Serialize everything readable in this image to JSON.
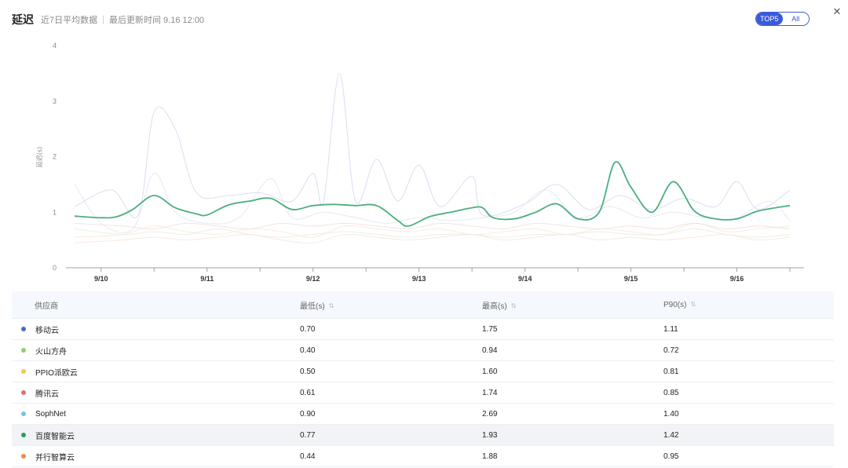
{
  "header": {
    "title": "延迟",
    "subtitle": "近7日平均数据",
    "separator": "|",
    "updated": "最后更新时间 9.16 12:00"
  },
  "toggle": {
    "option_top5": "TOP5",
    "option_all": "All"
  },
  "close_icon": "close-icon",
  "chart_data": {
    "type": "line",
    "ylabel": "延迟(s)",
    "ylim": [
      0,
      4
    ],
    "yticks": [
      "0",
      "1",
      "2",
      "3",
      "4"
    ],
    "x_labels": [
      "9/10",
      "9/11",
      "9/12",
      "9/13",
      "9/14",
      "9/15",
      "9/16"
    ],
    "x_range": [
      -0.25,
      6.5
    ],
    "grid": false,
    "highlight_color": "#4caf7d",
    "series": [
      {
        "name": "百度智能云",
        "color": "#4caf7d",
        "highlight": true,
        "points": [
          [
            -0.25,
            0.93
          ],
          [
            0.0,
            0.9
          ],
          [
            0.15,
            0.92
          ],
          [
            0.3,
            1.05
          ],
          [
            0.5,
            1.3
          ],
          [
            0.7,
            1.08
          ],
          [
            0.9,
            0.97
          ],
          [
            1.0,
            0.95
          ],
          [
            1.2,
            1.13
          ],
          [
            1.4,
            1.2
          ],
          [
            1.6,
            1.25
          ],
          [
            1.8,
            1.05
          ],
          [
            2.0,
            1.12
          ],
          [
            2.2,
            1.14
          ],
          [
            2.4,
            1.12
          ],
          [
            2.6,
            1.12
          ],
          [
            2.8,
            0.85
          ],
          [
            2.9,
            0.75
          ],
          [
            3.1,
            0.92
          ],
          [
            3.3,
            1.0
          ],
          [
            3.5,
            1.08
          ],
          [
            3.6,
            1.08
          ],
          [
            3.7,
            0.9
          ],
          [
            3.9,
            0.88
          ],
          [
            4.1,
            1.0
          ],
          [
            4.3,
            1.15
          ],
          [
            4.5,
            0.88
          ],
          [
            4.7,
            1.0
          ],
          [
            4.85,
            1.9
          ],
          [
            5.0,
            1.45
          ],
          [
            5.2,
            1.0
          ],
          [
            5.4,
            1.55
          ],
          [
            5.6,
            1.02
          ],
          [
            5.8,
            0.88
          ],
          [
            6.0,
            0.88
          ],
          [
            6.2,
            1.02
          ],
          [
            6.5,
            1.12
          ]
        ]
      },
      {
        "name": "SophNet",
        "color": "#cfd6ee",
        "highlight": false,
        "points": [
          [
            -0.25,
            1.1
          ],
          [
            0.1,
            1.4
          ],
          [
            0.35,
            0.95
          ],
          [
            0.5,
            2.8
          ],
          [
            0.7,
            2.5
          ],
          [
            0.9,
            1.35
          ],
          [
            1.2,
            1.3
          ],
          [
            1.5,
            1.35
          ],
          [
            1.8,
            1.2
          ],
          [
            2.0,
            1.7
          ],
          [
            2.1,
            1.2
          ],
          [
            2.25,
            3.5
          ],
          [
            2.4,
            1.2
          ],
          [
            2.6,
            1.95
          ],
          [
            2.8,
            1.2
          ],
          [
            3.0,
            1.85
          ],
          [
            3.2,
            1.1
          ],
          [
            3.5,
            1.65
          ],
          [
            3.6,
            0.95
          ],
          [
            4.0,
            1.15
          ],
          [
            4.3,
            1.5
          ],
          [
            4.6,
            1.05
          ],
          [
            4.9,
            1.3
          ],
          [
            5.2,
            1.05
          ],
          [
            5.5,
            1.25
          ],
          [
            5.8,
            1.1
          ],
          [
            6.0,
            1.55
          ],
          [
            6.2,
            1.05
          ],
          [
            6.5,
            1.4
          ]
        ]
      },
      {
        "name": "移动云",
        "color": "#dfe4f2",
        "highlight": false,
        "points": [
          [
            -0.25,
            1.5
          ],
          [
            0.0,
            0.8
          ],
          [
            0.3,
            0.7
          ],
          [
            0.5,
            1.7
          ],
          [
            0.7,
            1.0
          ],
          [
            1.0,
            0.8
          ],
          [
            1.3,
            0.9
          ],
          [
            1.6,
            1.6
          ],
          [
            1.8,
            0.9
          ],
          [
            2.1,
            1.0
          ],
          [
            2.4,
            0.9
          ],
          [
            2.7,
            0.8
          ],
          [
            3.0,
            0.9
          ],
          [
            3.3,
            0.85
          ],
          [
            3.6,
            0.9
          ],
          [
            3.9,
            1.0
          ],
          [
            4.2,
            1.4
          ],
          [
            4.5,
            0.9
          ],
          [
            4.8,
            1.1
          ],
          [
            5.1,
            0.9
          ],
          [
            5.4,
            1.0
          ],
          [
            5.7,
            0.9
          ],
          [
            6.0,
            0.9
          ],
          [
            6.3,
            1.2
          ],
          [
            6.5,
            0.85
          ]
        ]
      },
      {
        "name": "火山方舟",
        "color": "#e6ecd8",
        "highlight": false,
        "points": [
          [
            -0.25,
            0.7
          ],
          [
            0.2,
            0.6
          ],
          [
            0.5,
            0.65
          ],
          [
            0.8,
            0.6
          ],
          [
            1.1,
            0.7
          ],
          [
            1.4,
            0.6
          ],
          [
            1.7,
            0.55
          ],
          [
            2.0,
            0.6
          ],
          [
            2.3,
            0.65
          ],
          [
            2.6,
            0.6
          ],
          [
            2.9,
            0.55
          ],
          [
            3.2,
            0.6
          ],
          [
            3.5,
            0.6
          ],
          [
            3.8,
            0.55
          ],
          [
            4.1,
            0.6
          ],
          [
            4.4,
            0.6
          ],
          [
            4.7,
            0.65
          ],
          [
            5.0,
            0.6
          ],
          [
            5.3,
            0.6
          ],
          [
            5.6,
            0.7
          ],
          [
            5.9,
            0.6
          ],
          [
            6.2,
            0.55
          ],
          [
            6.5,
            0.6
          ]
        ]
      },
      {
        "name": "PPIO派欧云",
        "color": "#f5ead3",
        "highlight": false,
        "points": [
          [
            -0.25,
            0.55
          ],
          [
            0.2,
            0.6
          ],
          [
            0.5,
            0.75
          ],
          [
            0.8,
            0.65
          ],
          [
            1.1,
            0.6
          ],
          [
            1.4,
            0.7
          ],
          [
            1.7,
            0.65
          ],
          [
            2.0,
            0.55
          ],
          [
            2.3,
            0.75
          ],
          [
            2.6,
            0.7
          ],
          [
            2.9,
            0.65
          ],
          [
            3.2,
            0.7
          ],
          [
            3.5,
            0.6
          ],
          [
            3.8,
            0.65
          ],
          [
            4.1,
            0.7
          ],
          [
            4.4,
            0.6
          ],
          [
            4.7,
            0.7
          ],
          [
            5.0,
            0.65
          ],
          [
            5.3,
            0.6
          ],
          [
            5.6,
            0.8
          ],
          [
            5.9,
            0.65
          ],
          [
            6.2,
            0.7
          ],
          [
            6.5,
            0.75
          ]
        ]
      },
      {
        "name": "腾讯云",
        "color": "#f4dada",
        "highlight": false,
        "points": [
          [
            -0.25,
            0.8
          ],
          [
            0.2,
            0.75
          ],
          [
            0.5,
            0.7
          ],
          [
            0.8,
            0.8
          ],
          [
            1.1,
            0.75
          ],
          [
            1.4,
            0.7
          ],
          [
            1.7,
            0.8
          ],
          [
            2.0,
            0.75
          ],
          [
            2.3,
            0.8
          ],
          [
            2.6,
            0.75
          ],
          [
            2.9,
            0.7
          ],
          [
            3.2,
            0.8
          ],
          [
            3.5,
            0.75
          ],
          [
            3.8,
            0.7
          ],
          [
            4.1,
            0.8
          ],
          [
            4.4,
            0.75
          ],
          [
            4.7,
            0.7
          ],
          [
            5.0,
            0.75
          ],
          [
            5.3,
            0.7
          ],
          [
            5.6,
            0.8
          ],
          [
            5.9,
            0.7
          ],
          [
            6.2,
            0.75
          ],
          [
            6.5,
            0.7
          ]
        ]
      },
      {
        "name": "并行智算云",
        "color": "#f6e4d8",
        "highlight": false,
        "points": [
          [
            -0.25,
            0.45
          ],
          [
            0.2,
            0.5
          ],
          [
            0.5,
            0.55
          ],
          [
            0.8,
            0.5
          ],
          [
            1.1,
            0.55
          ],
          [
            1.4,
            0.6
          ],
          [
            1.7,
            0.5
          ],
          [
            2.0,
            0.45
          ],
          [
            2.3,
            0.6
          ],
          [
            2.6,
            0.55
          ],
          [
            2.9,
            0.5
          ],
          [
            3.2,
            0.55
          ],
          [
            3.5,
            0.6
          ],
          [
            3.8,
            0.5
          ],
          [
            4.1,
            0.55
          ],
          [
            4.4,
            0.6
          ],
          [
            4.7,
            0.5
          ],
          [
            5.0,
            0.55
          ],
          [
            5.3,
            0.5
          ],
          [
            5.6,
            0.55
          ],
          [
            5.9,
            0.6
          ],
          [
            6.2,
            0.5
          ],
          [
            6.5,
            0.55
          ]
        ]
      }
    ]
  },
  "table": {
    "headers": {
      "vendor": "供应商",
      "min": "最低(s)",
      "max": "最高(s)",
      "p90": "P90(s)",
      "sort_icon": "sort-icon"
    },
    "rows": [
      {
        "name": "移动云",
        "color": "#4b67c5",
        "min": "0.70",
        "max": "1.75",
        "p90": "1.11"
      },
      {
        "name": "火山方舟",
        "color": "#8fcc79",
        "min": "0.40",
        "max": "0.94",
        "p90": "0.72"
      },
      {
        "name": "PPIO派欧云",
        "color": "#f2c94c",
        "min": "0.50",
        "max": "1.60",
        "p90": "0.81"
      },
      {
        "name": "腾讯云",
        "color": "#e26f6f",
        "min": "0.61",
        "max": "1.74",
        "p90": "0.85"
      },
      {
        "name": "SophNet",
        "color": "#78c2dd",
        "min": "0.90",
        "max": "2.69",
        "p90": "1.40"
      },
      {
        "name": "百度智能云",
        "color": "#2f9d66",
        "min": "0.77",
        "max": "1.93",
        "p90": "1.42",
        "highlight": true
      },
      {
        "name": "并行智算云",
        "color": "#f08a4b",
        "min": "0.44",
        "max": "1.88",
        "p90": "0.95"
      }
    ]
  }
}
